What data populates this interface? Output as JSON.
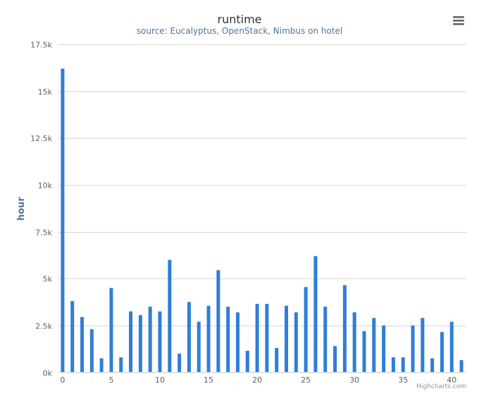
{
  "chart_data": {
    "type": "bar",
    "title": "runtime",
    "subtitle": "source: Eucalyptus, OpenStack, Nimbus on hotel",
    "xlabel": "",
    "ylabel": "hour",
    "x": [
      0,
      1,
      2,
      3,
      4,
      5,
      6,
      7,
      8,
      9,
      10,
      11,
      12,
      13,
      14,
      15,
      16,
      17,
      18,
      19,
      20,
      21,
      22,
      23,
      24,
      25,
      26,
      27,
      28,
      29,
      30,
      31,
      32,
      33,
      34,
      35,
      36,
      37,
      38,
      39,
      40,
      41
    ],
    "values": [
      16200,
      3800,
      2950,
      2300,
      750,
      4500,
      800,
      3250,
      3050,
      3500,
      3250,
      6000,
      1000,
      3750,
      2700,
      3550,
      5450,
      3500,
      3200,
      1150,
      3650,
      3650,
      1300,
      3550,
      3200,
      4550,
      6200,
      3500,
      1400,
      4650,
      3200,
      2200,
      2900,
      2500,
      800,
      800,
      2500,
      2900,
      750,
      2150,
      2700,
      650
    ],
    "xlim": [
      0,
      42
    ],
    "xticks": [
      {
        "value": 0,
        "label": "0"
      },
      {
        "value": 5,
        "label": "5"
      },
      {
        "value": 10,
        "label": "10"
      },
      {
        "value": 15,
        "label": "15"
      },
      {
        "value": 20,
        "label": "20"
      },
      {
        "value": 25,
        "label": "25"
      },
      {
        "value": 30,
        "label": "30"
      },
      {
        "value": 35,
        "label": "35"
      },
      {
        "value": 40,
        "label": "40"
      }
    ],
    "ylim": [
      0,
      17500
    ],
    "yticks": [
      {
        "value": 0,
        "label": "0k"
      },
      {
        "value": 2500,
        "label": "2.5k"
      },
      {
        "value": 5000,
        "label": "5k"
      },
      {
        "value": 7500,
        "label": "7.5k"
      },
      {
        "value": 10000,
        "label": "10k"
      },
      {
        "value": 12500,
        "label": "12.5k"
      },
      {
        "value": 15000,
        "label": "15k"
      },
      {
        "value": 17500,
        "label": "17.5k"
      }
    ],
    "grid": true,
    "legend": "none",
    "color": "#2f7ed8"
  },
  "menu": {
    "icon": "hamburger-menu-icon"
  },
  "credits": "Highcharts.com"
}
